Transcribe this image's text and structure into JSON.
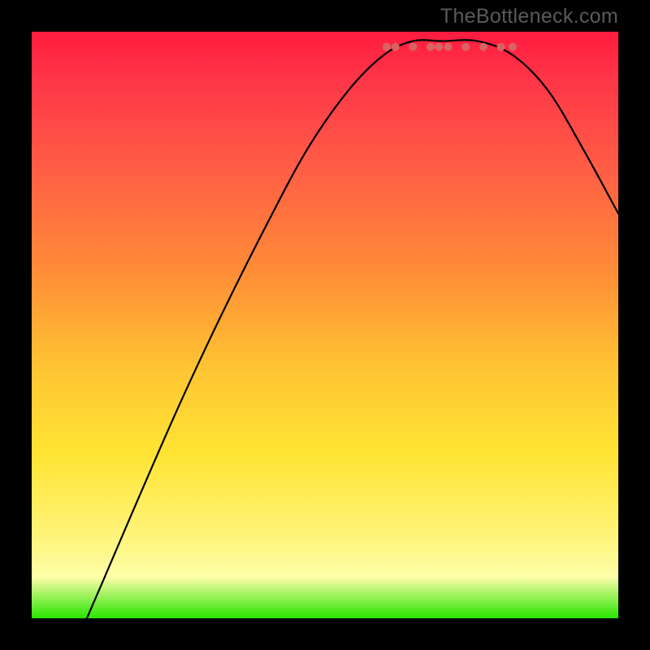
{
  "watermark": "TheBottleneck.com",
  "chart_data": {
    "type": "line",
    "title": "",
    "xlabel": "",
    "ylabel": "",
    "xlim": [
      0,
      1
    ],
    "ylim": [
      0,
      1
    ],
    "curve_points": [
      {
        "x": 0.094,
        "y": 0.0
      },
      {
        "x": 0.12,
        "y": 0.06
      },
      {
        "x": 0.18,
        "y": 0.2
      },
      {
        "x": 0.25,
        "y": 0.36
      },
      {
        "x": 0.32,
        "y": 0.51
      },
      {
        "x": 0.4,
        "y": 0.67
      },
      {
        "x": 0.47,
        "y": 0.8
      },
      {
        "x": 0.54,
        "y": 0.9
      },
      {
        "x": 0.6,
        "y": 0.96
      },
      {
        "x": 0.65,
        "y": 0.984
      },
      {
        "x": 0.7,
        "y": 0.984
      },
      {
        "x": 0.76,
        "y": 0.984
      },
      {
        "x": 0.82,
        "y": 0.96
      },
      {
        "x": 0.88,
        "y": 0.9
      },
      {
        "x": 0.94,
        "y": 0.8
      },
      {
        "x": 1.0,
        "y": 0.69
      }
    ],
    "bottom_markers_x": [
      0.605,
      0.62,
      0.65,
      0.68,
      0.694,
      0.71,
      0.74,
      0.77,
      0.8,
      0.82
    ],
    "bottom_marker_y": 0.974,
    "marker_color": "#d96363",
    "line_color": "#000000"
  }
}
